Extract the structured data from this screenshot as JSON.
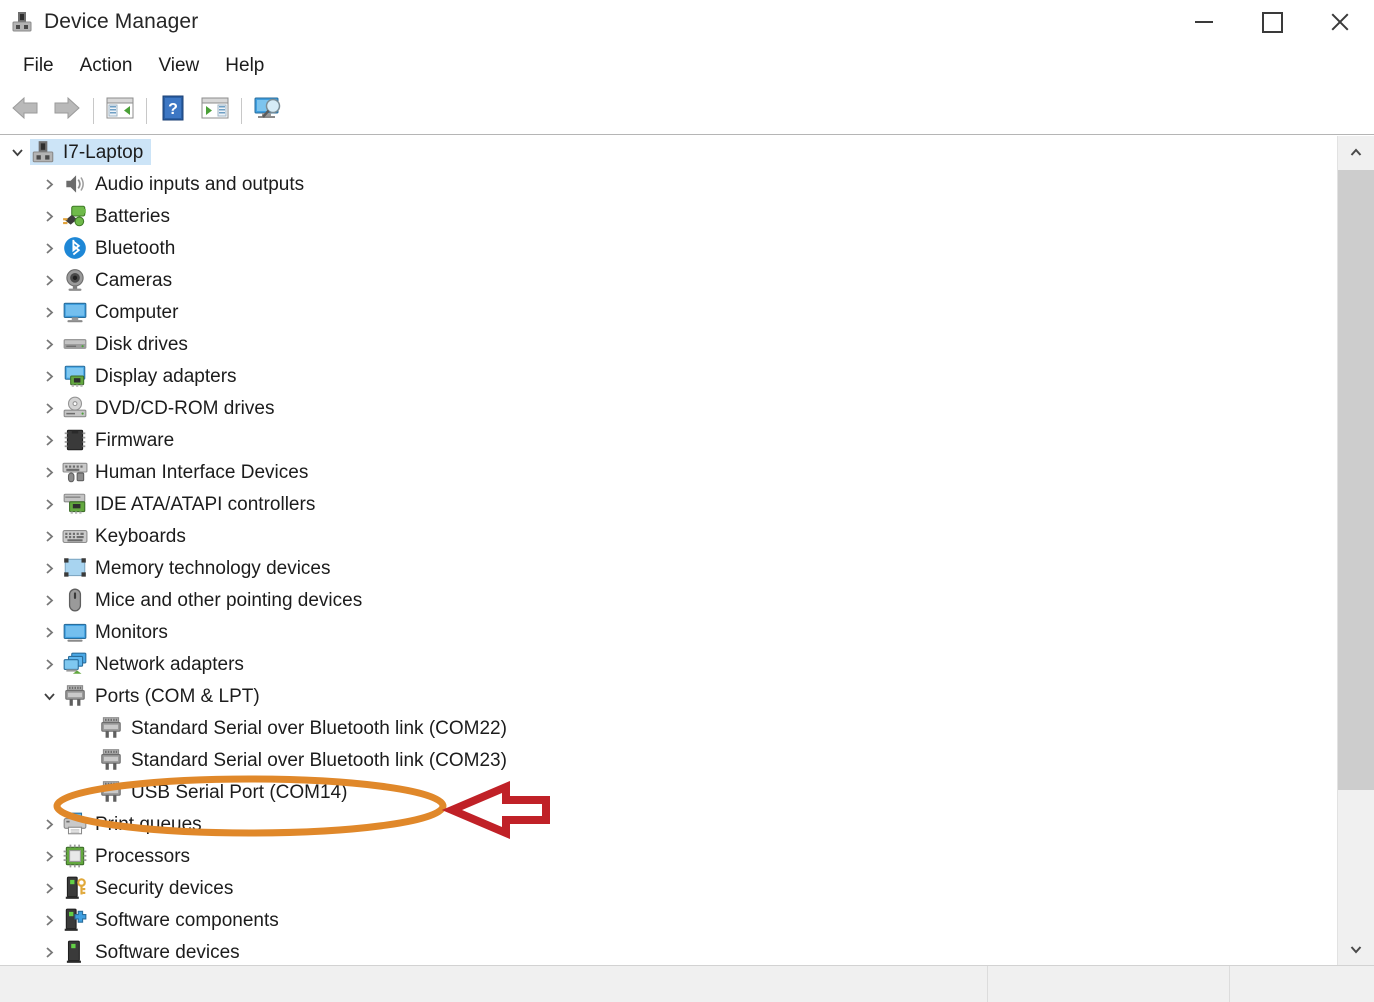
{
  "window": {
    "title": "Device Manager",
    "icon": "device-manager-icon",
    "controls": {
      "minimize": "–",
      "maximize": "□",
      "close": "✕"
    }
  },
  "menubar": {
    "items": [
      {
        "label": "File"
      },
      {
        "label": "Action"
      },
      {
        "label": "View"
      },
      {
        "label": "Help"
      }
    ]
  },
  "toolbar": {
    "buttons": [
      {
        "name": "back-arrow-icon",
        "tooltip": "Back"
      },
      {
        "name": "forward-arrow-icon",
        "tooltip": "Forward"
      },
      {
        "name": "show-hide-console-tree-icon",
        "tooltip": "Show/Hide console tree"
      },
      {
        "name": "help-icon",
        "tooltip": "Help"
      },
      {
        "name": "properties-icon",
        "tooltip": "Properties"
      },
      {
        "name": "scan-for-hardware-changes-icon",
        "tooltip": "Scan for hardware changes"
      }
    ]
  },
  "tree": {
    "root": {
      "label": "I7-Laptop",
      "icon": "computer-icon",
      "expanded": true,
      "selected": true,
      "level": 0
    },
    "items": [
      {
        "label": "Audio inputs and outputs",
        "icon": "speaker-icon",
        "expanded": false,
        "level": 1
      },
      {
        "label": "Batteries",
        "icon": "battery-icon",
        "expanded": false,
        "level": 1
      },
      {
        "label": "Bluetooth",
        "icon": "bluetooth-icon",
        "expanded": false,
        "level": 1
      },
      {
        "label": "Cameras",
        "icon": "camera-icon",
        "expanded": false,
        "level": 1
      },
      {
        "label": "Computer",
        "icon": "monitor-icon",
        "expanded": false,
        "level": 1
      },
      {
        "label": "Disk drives",
        "icon": "disk-drive-icon",
        "expanded": false,
        "level": 1
      },
      {
        "label": "Display adapters",
        "icon": "display-adapter-icon",
        "expanded": false,
        "level": 1
      },
      {
        "label": "DVD/CD-ROM drives",
        "icon": "optical-drive-icon",
        "expanded": false,
        "level": 1
      },
      {
        "label": "Firmware",
        "icon": "firmware-chip-icon",
        "expanded": false,
        "level": 1
      },
      {
        "label": "Human Interface Devices",
        "icon": "hid-icon",
        "expanded": false,
        "level": 1
      },
      {
        "label": "IDE ATA/ATAPI controllers",
        "icon": "ide-controller-icon",
        "expanded": false,
        "level": 1
      },
      {
        "label": "Keyboards",
        "icon": "keyboard-icon",
        "expanded": false,
        "level": 1
      },
      {
        "label": "Memory technology devices",
        "icon": "memory-technology-icon",
        "expanded": false,
        "level": 1
      },
      {
        "label": "Mice and other pointing devices",
        "icon": "mouse-icon",
        "expanded": false,
        "level": 1
      },
      {
        "label": "Monitors",
        "icon": "monitor-icon",
        "expanded": false,
        "level": 1
      },
      {
        "label": "Network adapters",
        "icon": "network-adapter-icon",
        "expanded": false,
        "level": 1
      },
      {
        "label": "Ports (COM & LPT)",
        "icon": "serial-port-icon",
        "expanded": true,
        "level": 1
      },
      {
        "label": "Standard Serial over Bluetooth link (COM22)",
        "icon": "serial-port-icon",
        "expanded": null,
        "level": 2
      },
      {
        "label": "Standard Serial over Bluetooth link (COM23)",
        "icon": "serial-port-icon",
        "expanded": null,
        "level": 2
      },
      {
        "label": "USB Serial Port (COM14)",
        "icon": "serial-port-icon",
        "expanded": null,
        "level": 2,
        "annotated": true
      },
      {
        "label": "Print queues",
        "icon": "printer-icon",
        "expanded": false,
        "level": 1
      },
      {
        "label": "Processors",
        "icon": "processor-icon",
        "expanded": false,
        "level": 1
      },
      {
        "label": "Security devices",
        "icon": "security-device-icon",
        "expanded": false,
        "level": 1
      },
      {
        "label": "Software components",
        "icon": "software-component-icon",
        "expanded": false,
        "level": 1
      },
      {
        "label": "Software devices",
        "icon": "software-device-icon",
        "expanded": false,
        "level": 1
      }
    ]
  },
  "scrollbar": {
    "up_arrow": "scroll-up-arrow-icon",
    "down_arrow": "scroll-down-arrow-icon",
    "orientation": "vertical"
  },
  "statusbar": {
    "cells": [
      "",
      "",
      ""
    ]
  },
  "annotations": {
    "ellipse": {
      "target": "USB Serial Port (COM14)",
      "color": "#E0882A",
      "shape": "ellipse"
    },
    "arrow": {
      "direction": "left",
      "color": "#C02127",
      "fill": "#FFFFFF",
      "points_at": "USB Serial Port (COM14)"
    }
  }
}
